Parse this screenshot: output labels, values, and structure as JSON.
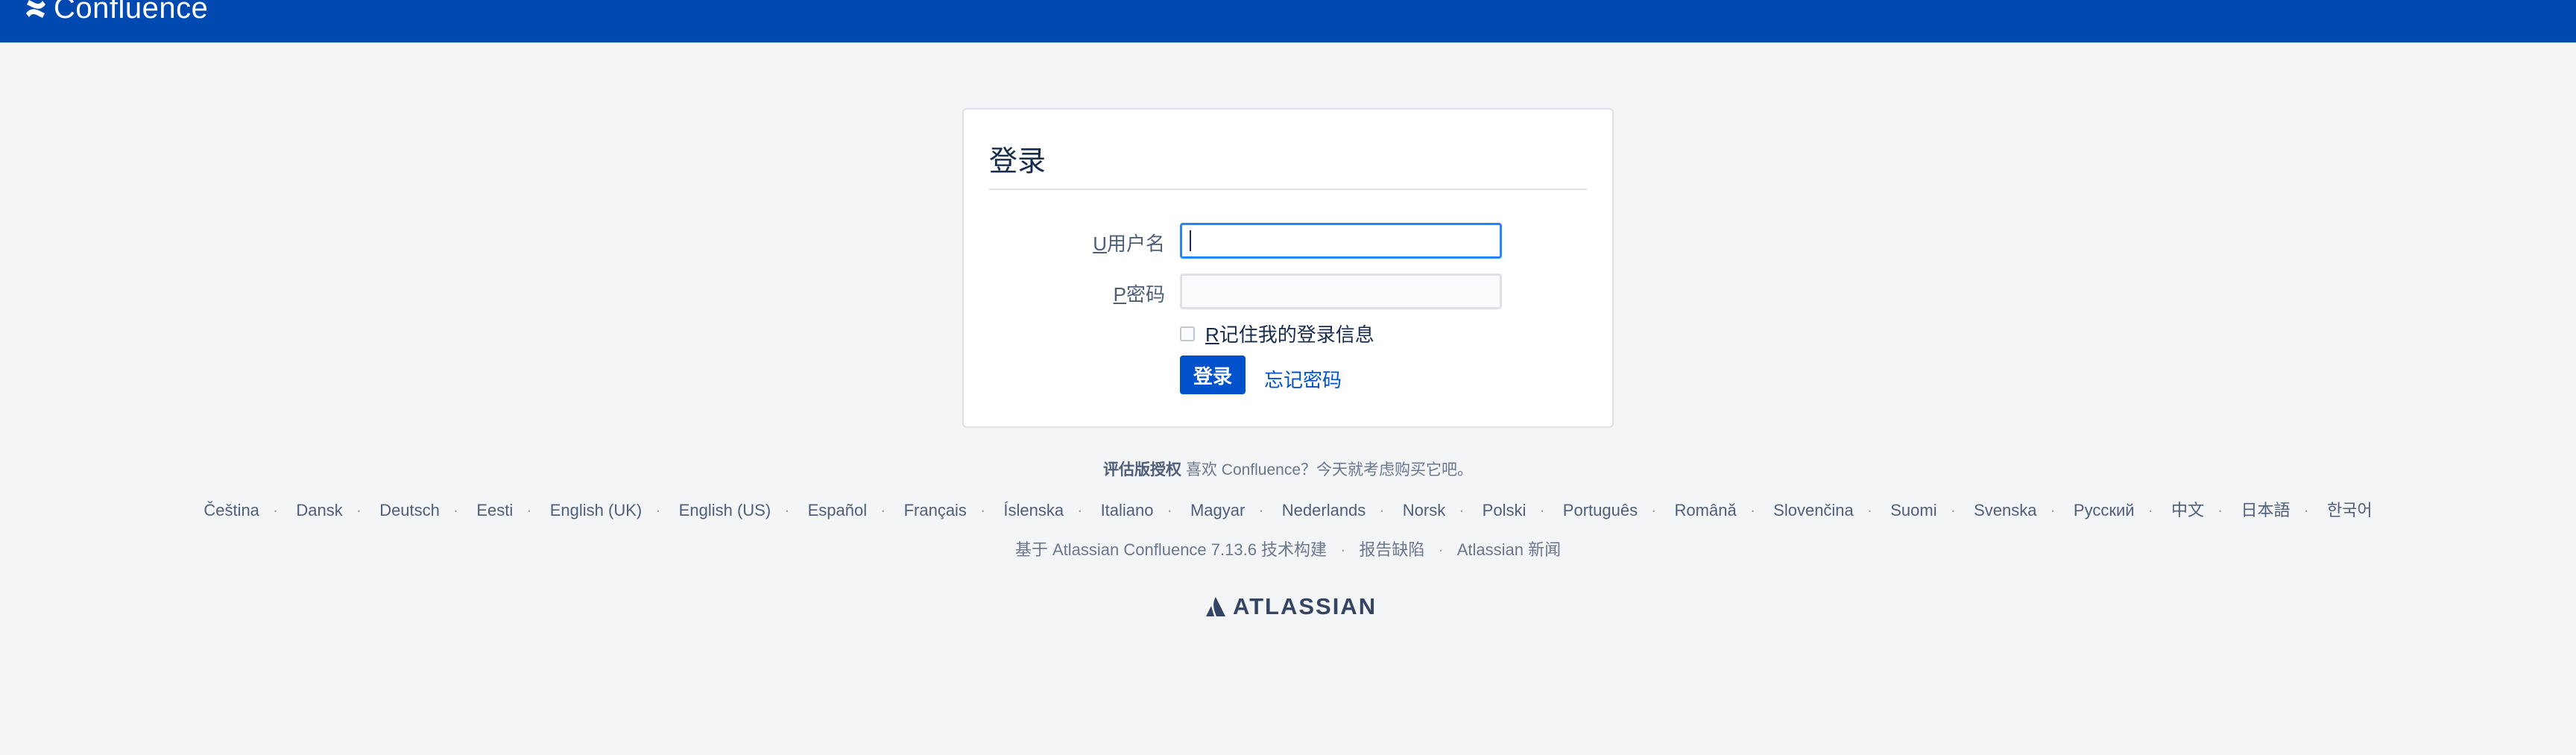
{
  "header": {
    "product_name": "Confluence",
    "logo_icon": "confluence-logo-icon",
    "background_color": "#0049b0"
  },
  "login": {
    "title": "登录",
    "username_label_access": "U",
    "username_label": "用户名",
    "username_value": "",
    "password_label_access": "P",
    "password_label": "密码",
    "password_value": "",
    "remember_access": "R",
    "remember_label": "记住我的登录信息",
    "remember_checked": false,
    "submit_label": "登录",
    "forgot_label": "忘记密码",
    "accent_color": "#0052cc"
  },
  "footer": {
    "eval_strong": "评估版授权",
    "eval_text": "喜欢 Confluence？今天就考虑购买它吧。",
    "languages": [
      "Čeština",
      "Dansk",
      "Deutsch",
      "Eesti",
      "English (UK)",
      "English (US)",
      "Español",
      "Français",
      "Íslenska",
      "Italiano",
      "Magyar",
      "Nederlands",
      "Norsk",
      "Polski",
      "Português",
      "Română",
      "Slovenčina",
      "Suomi",
      "Svenska",
      "Русский",
      "中文",
      "日本語",
      "한국어"
    ],
    "separator": "·",
    "powered_by": "基于 Atlassian Confluence 7.13.6 技术构建",
    "report_bug": "报告缺陷",
    "news": "Atlassian 新闻",
    "atlassian_logo_text": "ATLASSIAN",
    "atlassian_icon": "atlassian-logo-icon"
  }
}
